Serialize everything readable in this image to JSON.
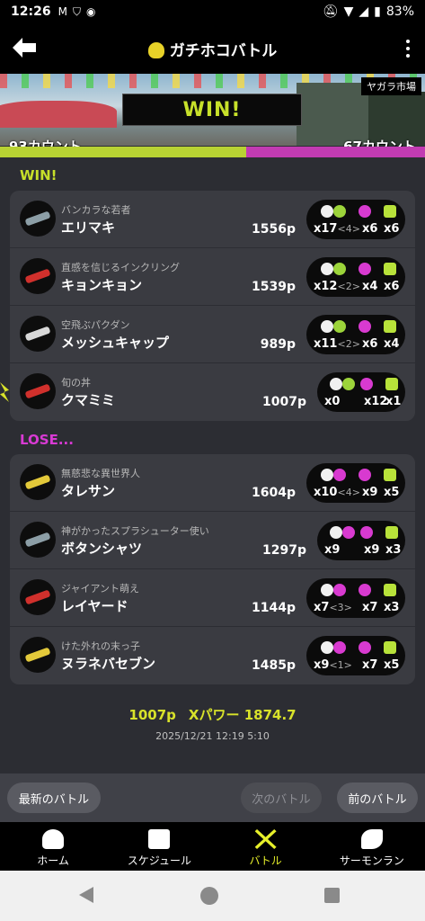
{
  "status": {
    "time": "12:26",
    "battery": "83%"
  },
  "header": {
    "title": "ガチホコバトル"
  },
  "banner": {
    "result": "WIN!",
    "stage": "ヤガラ市場",
    "score_left": "93カウント",
    "score_right": "67カウント",
    "score_left_fraction": 0.58
  },
  "win_team": {
    "label": "WIN!",
    "players": [
      {
        "byname": "バンカラな若者",
        "name": "エリマキ",
        "power": "1556p",
        "kills": "x17",
        "assists": "<4>",
        "specials_used": "x6",
        "specials": "x6"
      },
      {
        "byname": "直感を信じるインクリング",
        "name": "キョンキョン",
        "power": "1539p",
        "kills": "x12",
        "assists": "<2>",
        "specials_used": "x4",
        "specials": "x6"
      },
      {
        "byname": "空飛ぶパクダン",
        "name": "メッシュキャップ",
        "power": "989p",
        "kills": "x11",
        "assists": "<2>",
        "specials_used": "x6",
        "specials": "x4"
      },
      {
        "byname": "旬の丼",
        "name": "クマミミ",
        "power": "1007p",
        "kills": "x0",
        "assists": "",
        "specials_used": "x12",
        "specials": "x1"
      }
    ]
  },
  "lose_team": {
    "label": "LOSE...",
    "players": [
      {
        "byname": "無慈悲な異世界人",
        "name": "タレサン",
        "power": "1604p",
        "kills": "x10",
        "assists": "<4>",
        "specials_used": "x9",
        "specials": "x5"
      },
      {
        "byname": "神がかったスプラシューター使い",
        "name": "ボタンシャツ",
        "power": "1297p",
        "kills": "x9",
        "assists": "",
        "specials_used": "x9",
        "specials": "x3"
      },
      {
        "byname": "ジャイアント萌え",
        "name": "レイヤード",
        "power": "1144p",
        "kills": "x7",
        "assists": "<3>",
        "specials_used": "x7",
        "specials": "x3"
      },
      {
        "byname": "けた外れの末っ子",
        "name": "ヌラネバセブン",
        "power": "1485p",
        "kills": "x9",
        "assists": "<1>",
        "specials_used": "x7",
        "specials": "x5"
      }
    ]
  },
  "summary": {
    "power": "1007p",
    "xpower": "Xパワー 1874.7",
    "datetime": "2025/12/21  12:19  5:10"
  },
  "nav_buttons": {
    "latest": "最新のバトル",
    "next": "次のバトル",
    "prev": "前のバトル"
  },
  "tabs": [
    {
      "label": "ホーム",
      "icon": "squid-icon"
    },
    {
      "label": "スケジュール",
      "icon": "calendar-icon"
    },
    {
      "label": "バトル",
      "icon": "battle-icon"
    },
    {
      "label": "サーモンラン",
      "icon": "salmon-icon"
    }
  ],
  "colors": {
    "accent_green": "#c7e02a",
    "accent_magenta": "#d83ad0",
    "active_tab": "#e6ef2a"
  }
}
